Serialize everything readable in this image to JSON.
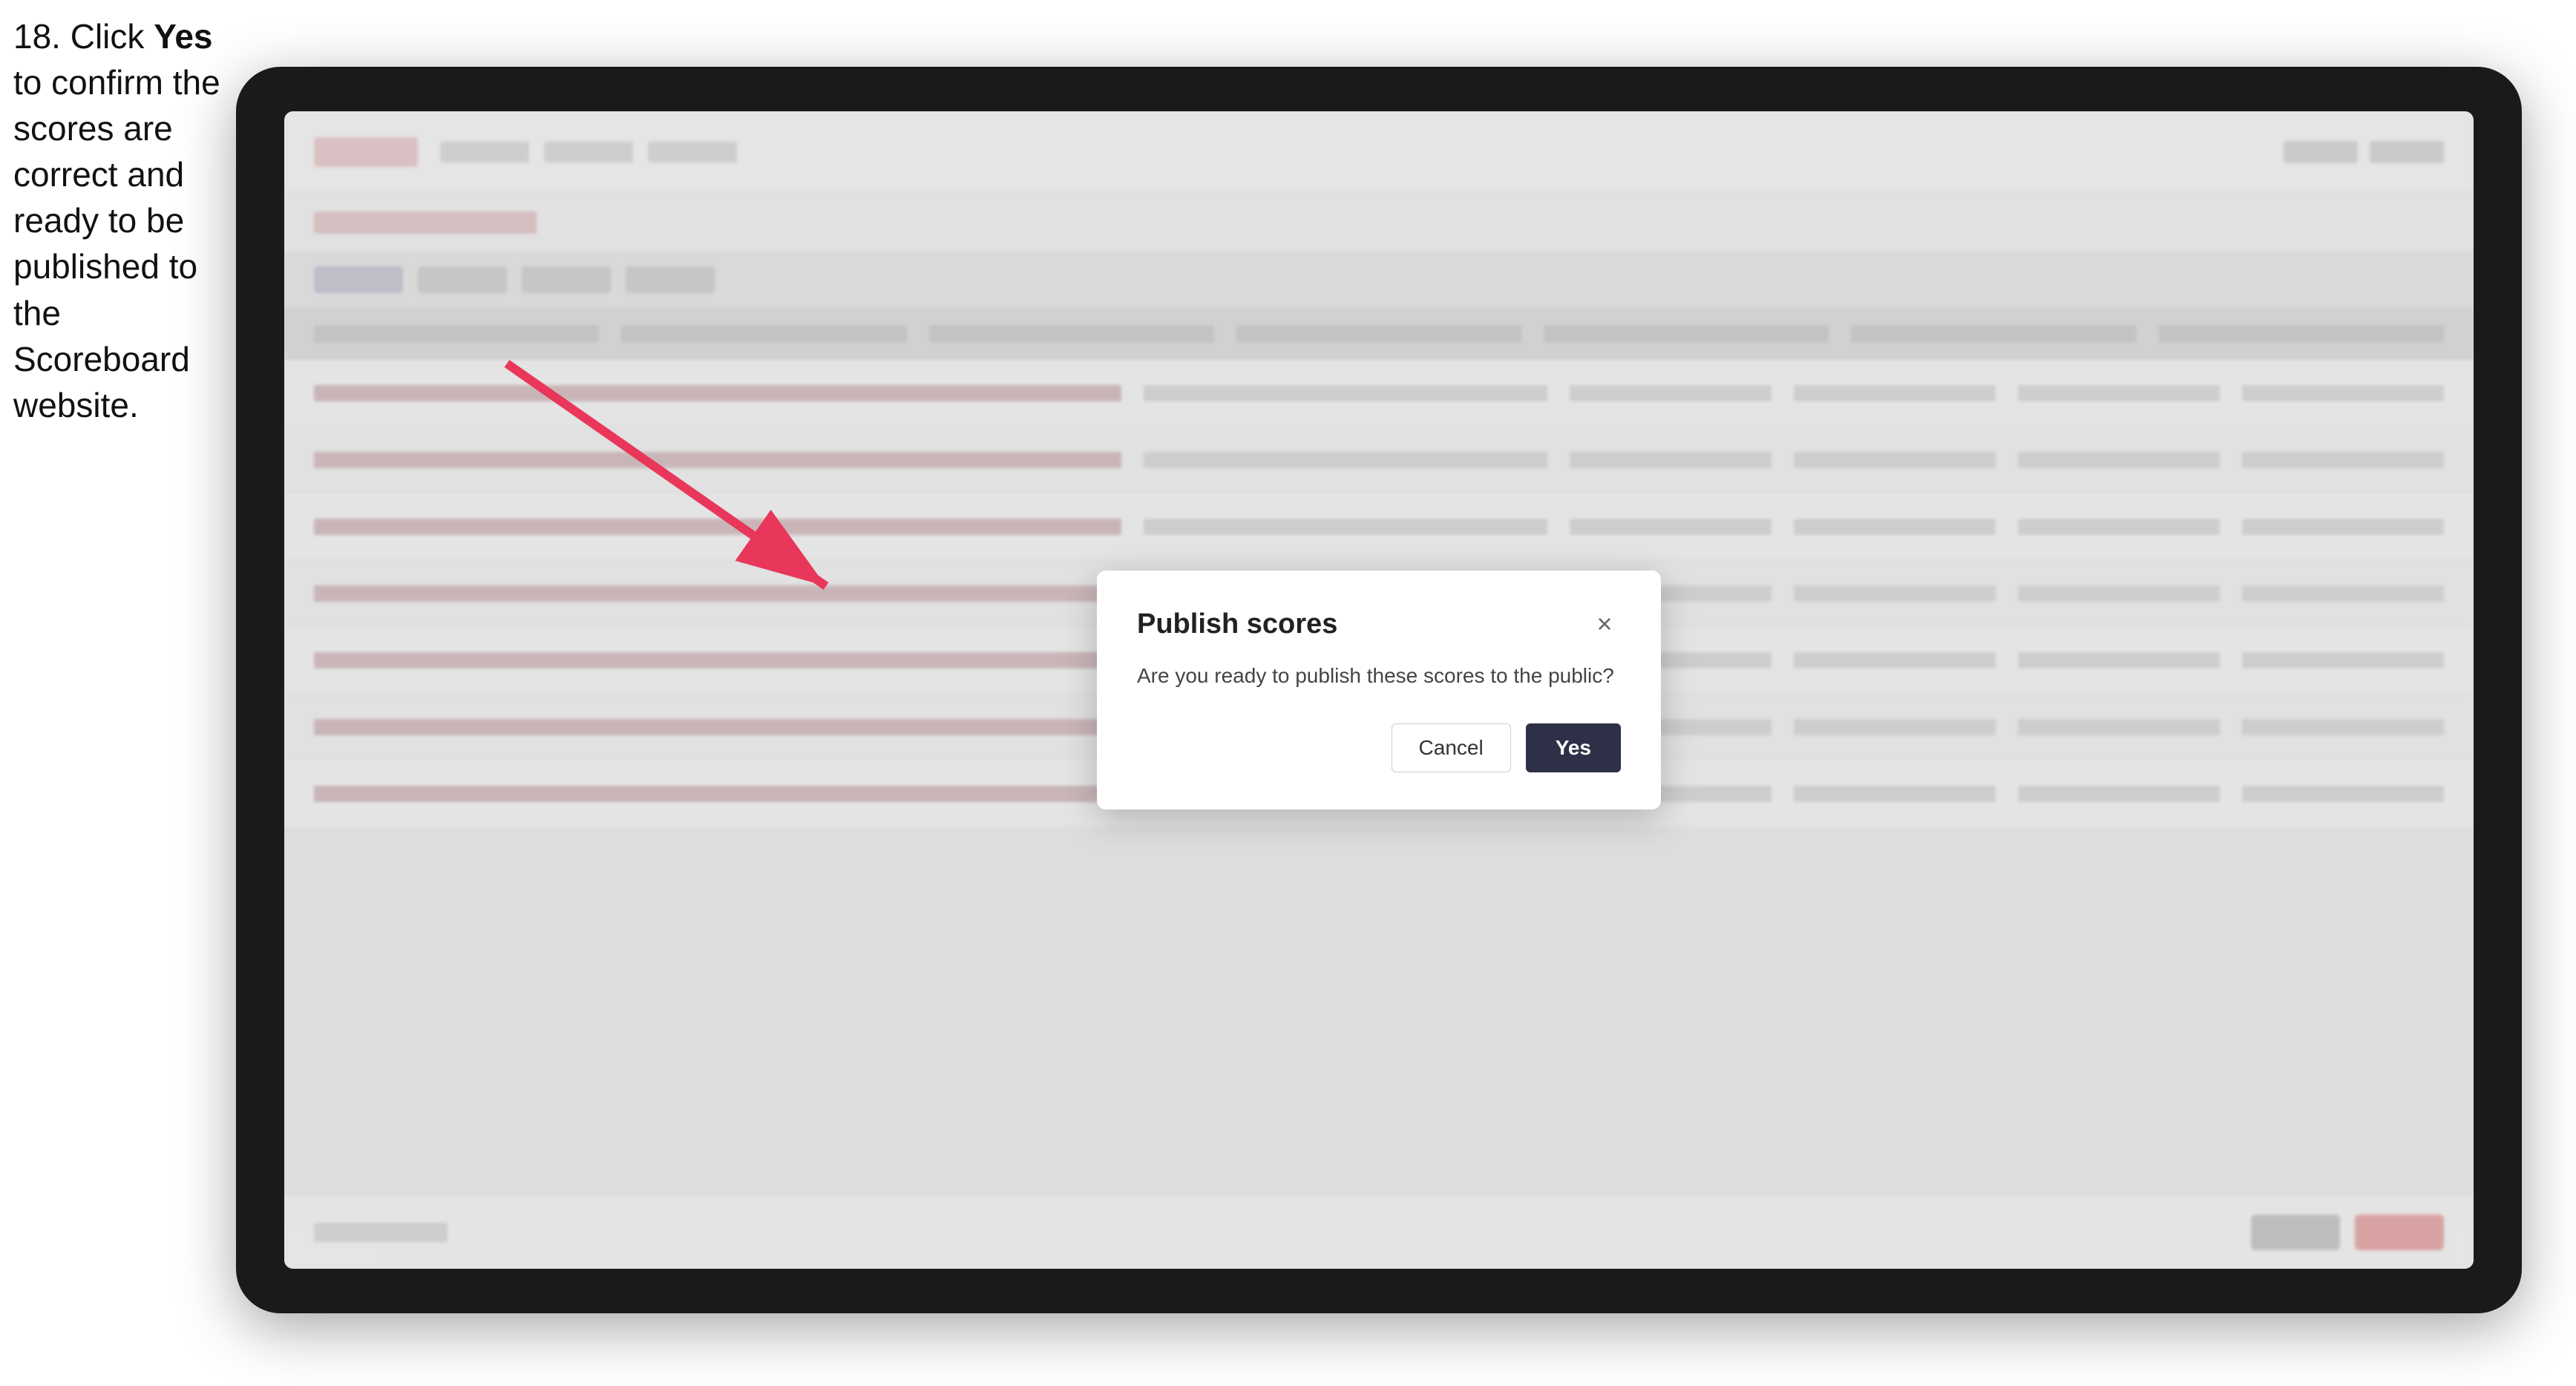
{
  "instruction": {
    "step_number": "18.",
    "text_before_bold": " Click ",
    "bold_text": "Yes",
    "text_after_bold": " to confirm the scores are correct and ready to be published to the Scoreboard website."
  },
  "tablet": {
    "bg_rows": 7
  },
  "modal": {
    "title": "Publish scores",
    "body_text": "Are you ready to publish these scores to the public?",
    "cancel_label": "Cancel",
    "yes_label": "Yes",
    "close_icon": "×"
  }
}
